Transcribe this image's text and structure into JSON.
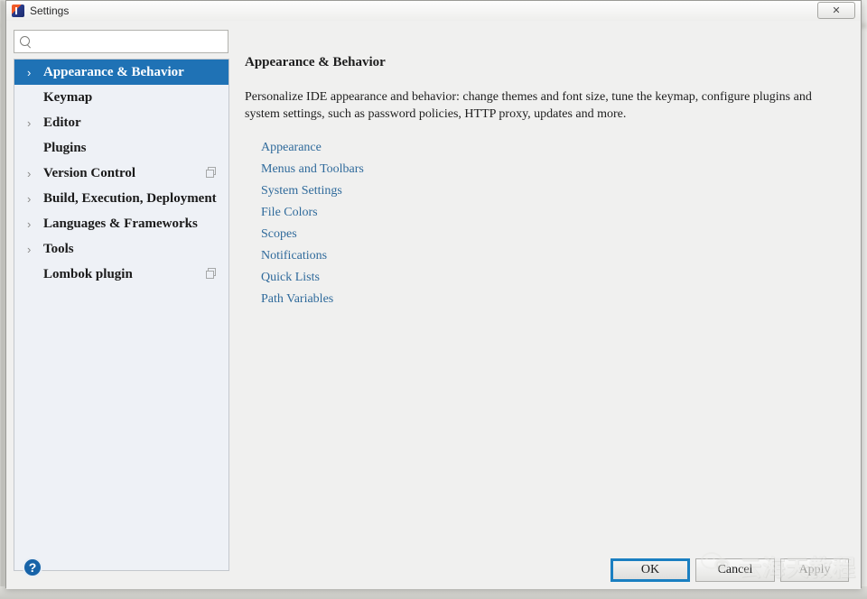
{
  "window": {
    "title": "Settings",
    "app_icon": "intellij-idea-icon",
    "close_label": "✕"
  },
  "search": {
    "value": "",
    "placeholder": "",
    "icon": "search-icon"
  },
  "sidebar": {
    "items": [
      {
        "label": "Appearance & Behavior",
        "expandable": true,
        "selected": true,
        "badge": false
      },
      {
        "label": "Keymap",
        "expandable": false,
        "selected": false,
        "badge": false
      },
      {
        "label": "Editor",
        "expandable": true,
        "selected": false,
        "badge": false
      },
      {
        "label": "Plugins",
        "expandable": false,
        "selected": false,
        "badge": false
      },
      {
        "label": "Version Control",
        "expandable": true,
        "selected": false,
        "badge": true
      },
      {
        "label": "Build, Execution, Deployment",
        "expandable": true,
        "selected": false,
        "badge": false
      },
      {
        "label": "Languages & Frameworks",
        "expandable": true,
        "selected": false,
        "badge": false
      },
      {
        "label": "Tools",
        "expandable": true,
        "selected": false,
        "badge": false
      },
      {
        "label": "Lombok plugin",
        "expandable": false,
        "selected": false,
        "badge": true
      }
    ],
    "chevron_glyph": "›"
  },
  "content": {
    "title": "Appearance & Behavior",
    "description": "Personalize IDE appearance and behavior: change themes and font size, tune the keymap, configure plugins and system settings, such as password policies, HTTP proxy, updates and more.",
    "links": [
      "Appearance",
      "Menus and Toolbars",
      "System Settings",
      "File Colors",
      "Scopes",
      "Notifications",
      "Quick Lists",
      "Path Variables"
    ]
  },
  "footer": {
    "help_label": "?",
    "ok_label": "OK",
    "cancel_label": "Cancel",
    "apply_label": "Apply"
  },
  "watermark": {
    "text": "云海天教程",
    "logo": "wechat-logo"
  },
  "colors": {
    "selection_blue": "#1f72b5",
    "link_blue": "#2f6a9b",
    "focus_ring": "#1a7fc1",
    "help_blue": "#1763a8",
    "sidebar_bg": "#eef1f6",
    "dialog_bg": "#f0f0ef"
  }
}
